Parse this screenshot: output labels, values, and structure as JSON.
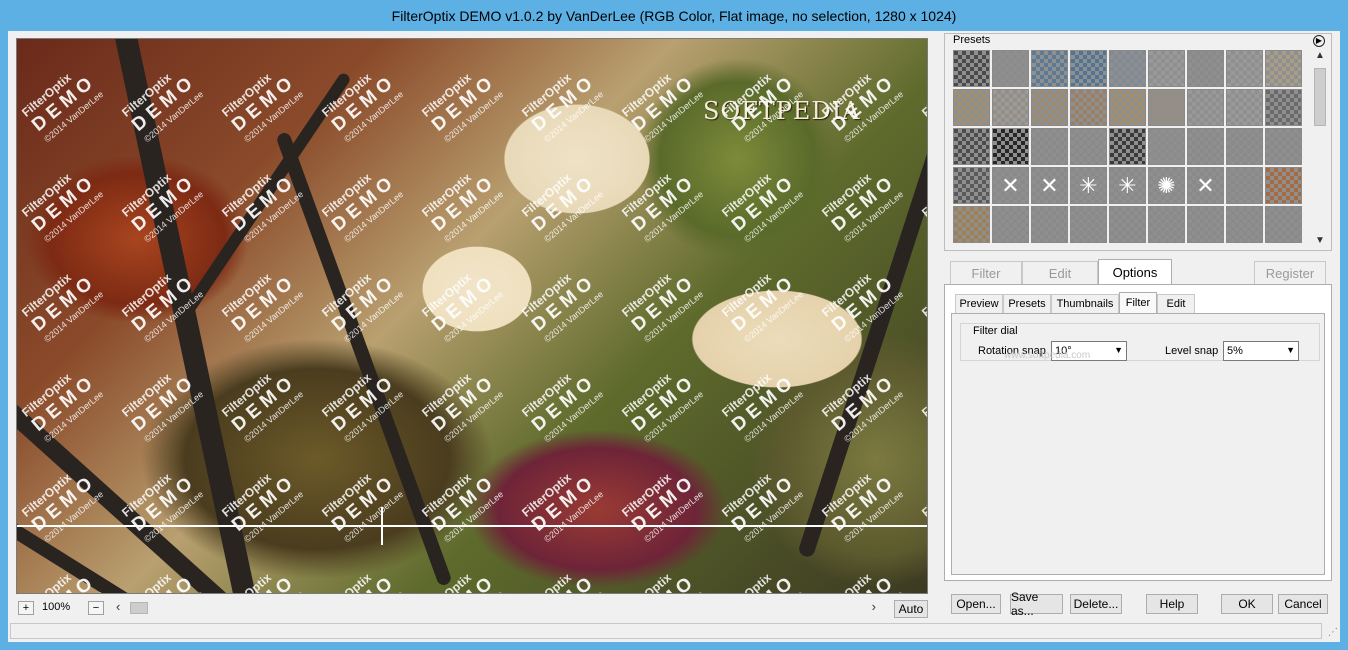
{
  "window": {
    "title": "FilterOptix DEMO v1.0.2 by VanDerLee (RGB Color, Flat image, no selection, 1280 x 1024)"
  },
  "preview": {
    "watermark_line1": "FilterOptix",
    "watermark_line2": "DEMO",
    "watermark_line3": "©2014 VanDerLee",
    "logo_text": "SOFTPEDIA"
  },
  "zoom": {
    "plus_label": "+",
    "minus_label": "−",
    "value": "100%",
    "auto_label": "Auto"
  },
  "presets": {
    "label": "Presets",
    "cell_glyphs": [
      "",
      "",
      "",
      "",
      "",
      "",
      "",
      "",
      "",
      "",
      "",
      "",
      "",
      "",
      "",
      "",
      "",
      "",
      "",
      "",
      "",
      "",
      "",
      "",
      "",
      "",
      "",
      "",
      "✕",
      "✕",
      "✳",
      "✳",
      "✺",
      "✕",
      "",
      "",
      "",
      "",
      "",
      "",
      "",
      "",
      "",
      "",
      ""
    ],
    "cell_tints": [
      "#4a4a4a",
      "#8c8c8c",
      "#5a7a95",
      "#4f7494",
      "#7f8a96",
      "#9a9a9a",
      "#8a8a8a",
      "#9a9a9a",
      "#a89e88",
      "#a09070",
      "#a09a90",
      "#9c8a72",
      "#9a7f62",
      "#a38e6c",
      "#988c80",
      "#989898",
      "#9a9a9a",
      "#6a6a6a",
      "#4c4c4c",
      "#262626",
      "#8a8a8a",
      "#8a8a8a",
      "#3a3a3a",
      "#8c8c8c",
      "#8a8a8a",
      "#8a8a8a",
      "#8a8a8a",
      "#5a5a5a",
      "#8a8a8a",
      "#8a8a8a",
      "#8a8a8a",
      "#8a8a8a",
      "#8a8a8a",
      "#8a8a8a",
      "#8a8a8a",
      "#a86a40",
      "#a08050",
      "#8a8a8a",
      "#8a8a8a",
      "#8a8a8a",
      "#8a8a8a",
      "#8a8a8a",
      "#8a8a8a",
      "#8a8a8a",
      "#8a8a8a"
    ]
  },
  "main_tabs": [
    "Filter",
    "Edit",
    "Options",
    "Register"
  ],
  "sub_tabs": [
    "Preview",
    "Presets",
    "Thumbnails",
    "Filter",
    "Edit"
  ],
  "filter_dial": {
    "group_title": "Filter dial",
    "rotation_label": "Rotation snap",
    "rotation_value": "10°",
    "level_label": "Level snap",
    "level_value": "5%",
    "watermark": "www.softpedia.com"
  },
  "buttons": {
    "open": "Open...",
    "save_as": "Save as...",
    "delete": "Delete...",
    "help": "Help",
    "ok": "OK",
    "cancel": "Cancel"
  }
}
